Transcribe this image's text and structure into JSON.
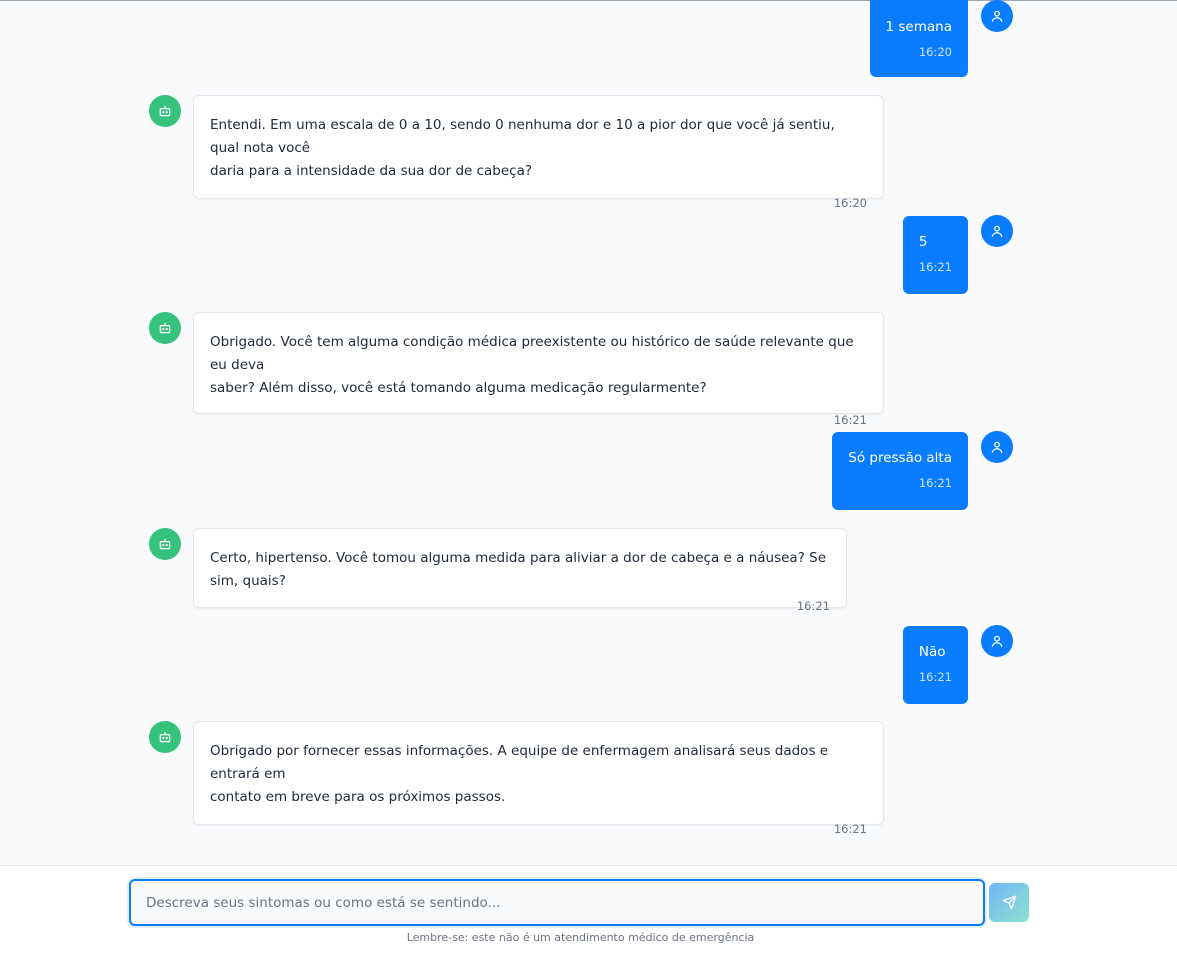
{
  "messages": [
    {
      "role": "user",
      "text": "1 semana",
      "time": "16:20"
    },
    {
      "role": "bot",
      "text": "Entendi. Em uma escala de 0 a 10, sendo 0 nenhuma dor e 10 a pior dor que você já sentiu, qual nota você\ndaria para a intensidade da sua dor de cabeça?",
      "time": "16:20"
    },
    {
      "role": "user",
      "text": "5",
      "time": "16:21"
    },
    {
      "role": "bot",
      "text": "Obrigado. Você tem alguma condição médica preexistente ou histórico de saúde relevante que eu deva\nsaber? Além disso, você está tomando alguma medicação regularmente?",
      "time": "16:21"
    },
    {
      "role": "user",
      "text": "Só pressão alta",
      "time": "16:21"
    },
    {
      "role": "bot",
      "text": "Certo, hipertenso. Você tomou alguma medida para aliviar a dor de cabeça e a náusea? Se sim, quais?",
      "time": "16:21"
    },
    {
      "role": "user",
      "text": "Não",
      "time": "16:21"
    },
    {
      "role": "bot",
      "text": "Obrigado por fornecer essas informações. A equipe de enfermagem analisará seus dados e entrará em\ncontato em breve para os próximos passos.",
      "time": "16:21"
    }
  ],
  "composer": {
    "value": "",
    "placeholder": "Descreva seus sintomas ou como está se sentindo...",
    "send_icon": "send-icon"
  },
  "disclaimer": "Lembre-se: este não é um atendimento médico de emergência",
  "colors": {
    "user_bubble": "#0a7cff",
    "bot_avatar": "#34c27c",
    "user_avatar": "#0a7cff"
  }
}
